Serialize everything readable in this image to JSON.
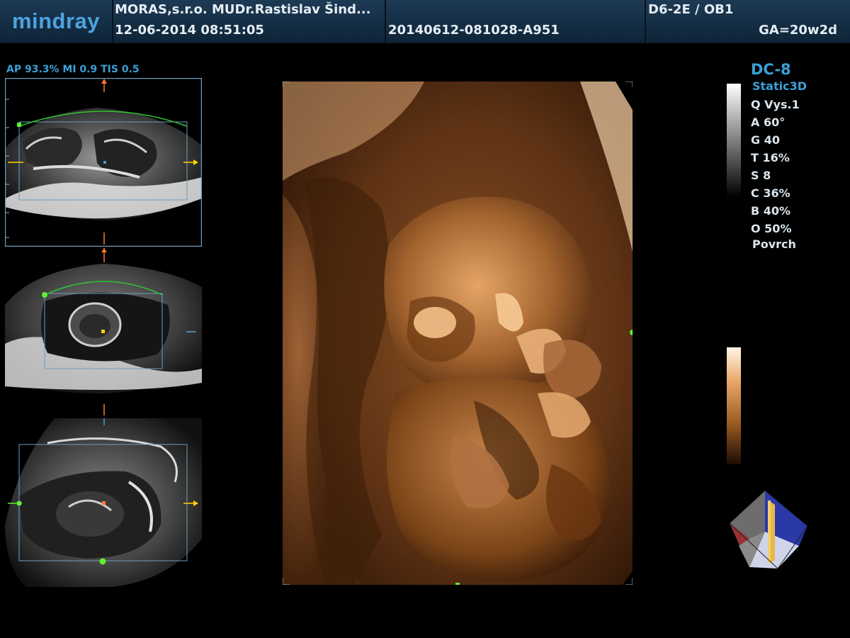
{
  "header": {
    "logo": "mindray",
    "institution": "MORAS,s.r.o. MUDr.Rastislav Šind...",
    "datetime": "12-06-2014  08:51:05",
    "exam_id": "20140612-081028-A951",
    "probe": "D6-2E / OB1",
    "gestational_age": "GA=20w2d"
  },
  "readout": "AP 93.3%  MI 0.9  TIS 0.5",
  "params": {
    "title": "DC-8",
    "mode": "Static3D",
    "items": [
      "Q Vys.1",
      "A 60°",
      "G 40",
      "T 16%",
      "S 8",
      "C 36%",
      "B 40%",
      "O 50%"
    ],
    "render": "Povrch"
  },
  "panes": [
    "plane-a",
    "plane-b",
    "plane-c"
  ],
  "colors": {
    "accent": "#3a9fd6",
    "header_bg": "#1a3550",
    "roi_curve": "#2ec62e",
    "marker_green": "#5ef02f",
    "marker_orange": "#ff7a33",
    "marker_yellow": "#ffd400",
    "render_base": "#8a5224"
  }
}
